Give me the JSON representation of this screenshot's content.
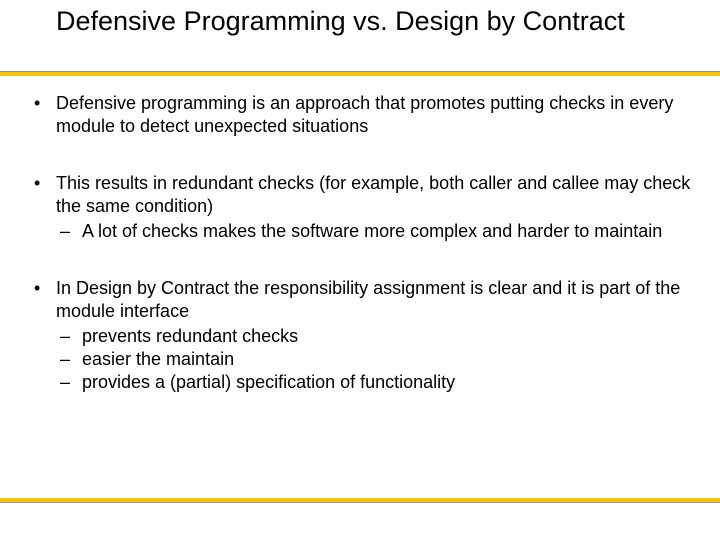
{
  "title": "Defensive Programming vs. Design by Contract",
  "bullets": [
    {
      "text": "Defensive programming is an approach that promotes putting checks in every module to detect unexpected situations"
    },
    {
      "text": "This results in redundant checks (for example, both caller and callee may check the same condition)",
      "sub": [
        "A lot of checks makes the software more complex and  harder to maintain"
      ]
    },
    {
      "text": "In Design by Contract the responsibility assignment is clear and it is part of the module interface",
      "sub": [
        "prevents redundant checks",
        "easier the maintain",
        "provides a (partial) specification of functionality"
      ]
    }
  ],
  "colors": {
    "accent": "#f3c20c"
  }
}
